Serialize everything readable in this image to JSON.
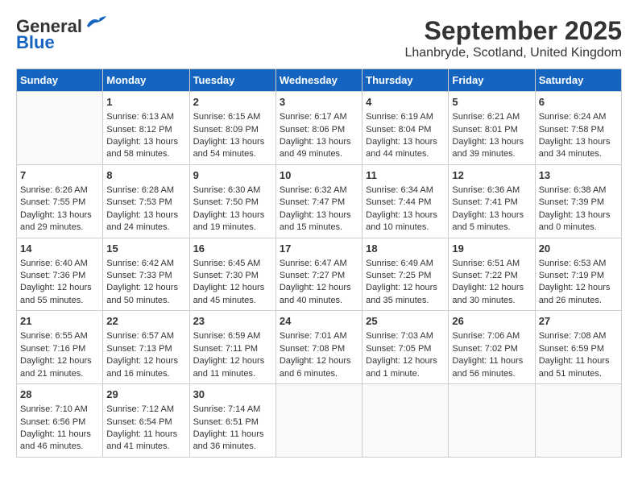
{
  "header": {
    "logo_general": "General",
    "logo_blue": "Blue",
    "month_title": "September 2025",
    "location": "Lhanbryde, Scotland, United Kingdom"
  },
  "calendar": {
    "days_of_week": [
      "Sunday",
      "Monday",
      "Tuesday",
      "Wednesday",
      "Thursday",
      "Friday",
      "Saturday"
    ],
    "weeks": [
      [
        {
          "day": "",
          "sunrise": "",
          "sunset": "",
          "daylight": ""
        },
        {
          "day": "1",
          "sunrise": "Sunrise: 6:13 AM",
          "sunset": "Sunset: 8:12 PM",
          "daylight": "Daylight: 13 hours and 58 minutes."
        },
        {
          "day": "2",
          "sunrise": "Sunrise: 6:15 AM",
          "sunset": "Sunset: 8:09 PM",
          "daylight": "Daylight: 13 hours and 54 minutes."
        },
        {
          "day": "3",
          "sunrise": "Sunrise: 6:17 AM",
          "sunset": "Sunset: 8:06 PM",
          "daylight": "Daylight: 13 hours and 49 minutes."
        },
        {
          "day": "4",
          "sunrise": "Sunrise: 6:19 AM",
          "sunset": "Sunset: 8:04 PM",
          "daylight": "Daylight: 13 hours and 44 minutes."
        },
        {
          "day": "5",
          "sunrise": "Sunrise: 6:21 AM",
          "sunset": "Sunset: 8:01 PM",
          "daylight": "Daylight: 13 hours and 39 minutes."
        },
        {
          "day": "6",
          "sunrise": "Sunrise: 6:24 AM",
          "sunset": "Sunset: 7:58 PM",
          "daylight": "Daylight: 13 hours and 34 minutes."
        }
      ],
      [
        {
          "day": "7",
          "sunrise": "Sunrise: 6:26 AM",
          "sunset": "Sunset: 7:55 PM",
          "daylight": "Daylight: 13 hours and 29 minutes."
        },
        {
          "day": "8",
          "sunrise": "Sunrise: 6:28 AM",
          "sunset": "Sunset: 7:53 PM",
          "daylight": "Daylight: 13 hours and 24 minutes."
        },
        {
          "day": "9",
          "sunrise": "Sunrise: 6:30 AM",
          "sunset": "Sunset: 7:50 PM",
          "daylight": "Daylight: 13 hours and 19 minutes."
        },
        {
          "day": "10",
          "sunrise": "Sunrise: 6:32 AM",
          "sunset": "Sunset: 7:47 PM",
          "daylight": "Daylight: 13 hours and 15 minutes."
        },
        {
          "day": "11",
          "sunrise": "Sunrise: 6:34 AM",
          "sunset": "Sunset: 7:44 PM",
          "daylight": "Daylight: 13 hours and 10 minutes."
        },
        {
          "day": "12",
          "sunrise": "Sunrise: 6:36 AM",
          "sunset": "Sunset: 7:41 PM",
          "daylight": "Daylight: 13 hours and 5 minutes."
        },
        {
          "day": "13",
          "sunrise": "Sunrise: 6:38 AM",
          "sunset": "Sunset: 7:39 PM",
          "daylight": "Daylight: 13 hours and 0 minutes."
        }
      ],
      [
        {
          "day": "14",
          "sunrise": "Sunrise: 6:40 AM",
          "sunset": "Sunset: 7:36 PM",
          "daylight": "Daylight: 12 hours and 55 minutes."
        },
        {
          "day": "15",
          "sunrise": "Sunrise: 6:42 AM",
          "sunset": "Sunset: 7:33 PM",
          "daylight": "Daylight: 12 hours and 50 minutes."
        },
        {
          "day": "16",
          "sunrise": "Sunrise: 6:45 AM",
          "sunset": "Sunset: 7:30 PM",
          "daylight": "Daylight: 12 hours and 45 minutes."
        },
        {
          "day": "17",
          "sunrise": "Sunrise: 6:47 AM",
          "sunset": "Sunset: 7:27 PM",
          "daylight": "Daylight: 12 hours and 40 minutes."
        },
        {
          "day": "18",
          "sunrise": "Sunrise: 6:49 AM",
          "sunset": "Sunset: 7:25 PM",
          "daylight": "Daylight: 12 hours and 35 minutes."
        },
        {
          "day": "19",
          "sunrise": "Sunrise: 6:51 AM",
          "sunset": "Sunset: 7:22 PM",
          "daylight": "Daylight: 12 hours and 30 minutes."
        },
        {
          "day": "20",
          "sunrise": "Sunrise: 6:53 AM",
          "sunset": "Sunset: 7:19 PM",
          "daylight": "Daylight: 12 hours and 26 minutes."
        }
      ],
      [
        {
          "day": "21",
          "sunrise": "Sunrise: 6:55 AM",
          "sunset": "Sunset: 7:16 PM",
          "daylight": "Daylight: 12 hours and 21 minutes."
        },
        {
          "day": "22",
          "sunrise": "Sunrise: 6:57 AM",
          "sunset": "Sunset: 7:13 PM",
          "daylight": "Daylight: 12 hours and 16 minutes."
        },
        {
          "day": "23",
          "sunrise": "Sunrise: 6:59 AM",
          "sunset": "Sunset: 7:11 PM",
          "daylight": "Daylight: 12 hours and 11 minutes."
        },
        {
          "day": "24",
          "sunrise": "Sunrise: 7:01 AM",
          "sunset": "Sunset: 7:08 PM",
          "daylight": "Daylight: 12 hours and 6 minutes."
        },
        {
          "day": "25",
          "sunrise": "Sunrise: 7:03 AM",
          "sunset": "Sunset: 7:05 PM",
          "daylight": "Daylight: 12 hours and 1 minute."
        },
        {
          "day": "26",
          "sunrise": "Sunrise: 7:06 AM",
          "sunset": "Sunset: 7:02 PM",
          "daylight": "Daylight: 11 hours and 56 minutes."
        },
        {
          "day": "27",
          "sunrise": "Sunrise: 7:08 AM",
          "sunset": "Sunset: 6:59 PM",
          "daylight": "Daylight: 11 hours and 51 minutes."
        }
      ],
      [
        {
          "day": "28",
          "sunrise": "Sunrise: 7:10 AM",
          "sunset": "Sunset: 6:56 PM",
          "daylight": "Daylight: 11 hours and 46 minutes."
        },
        {
          "day": "29",
          "sunrise": "Sunrise: 7:12 AM",
          "sunset": "Sunset: 6:54 PM",
          "daylight": "Daylight: 11 hours and 41 minutes."
        },
        {
          "day": "30",
          "sunrise": "Sunrise: 7:14 AM",
          "sunset": "Sunset: 6:51 PM",
          "daylight": "Daylight: 11 hours and 36 minutes."
        },
        {
          "day": "",
          "sunrise": "",
          "sunset": "",
          "daylight": ""
        },
        {
          "day": "",
          "sunrise": "",
          "sunset": "",
          "daylight": ""
        },
        {
          "day": "",
          "sunrise": "",
          "sunset": "",
          "daylight": ""
        },
        {
          "day": "",
          "sunrise": "",
          "sunset": "",
          "daylight": ""
        }
      ]
    ]
  }
}
